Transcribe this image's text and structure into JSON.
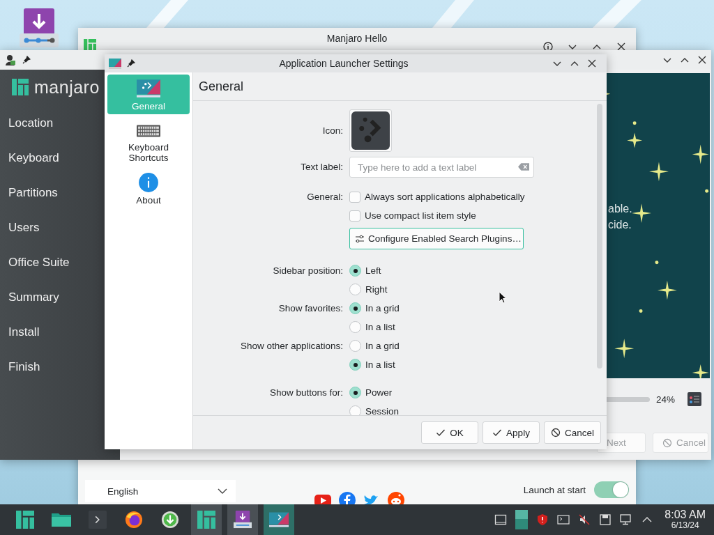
{
  "hello_window": {
    "title": "Manjaro Hello",
    "language": "English",
    "launch_at_start": {
      "label": "Launch at start",
      "on": true
    }
  },
  "installer_window": {
    "brand": "manjaro",
    "steps": [
      {
        "label": "Location",
        "selected": false
      },
      {
        "label": "Keyboard",
        "selected": false
      },
      {
        "label": "Partitions",
        "selected": false
      },
      {
        "label": "Users",
        "selected": false
      },
      {
        "label": "Office Suite",
        "selected": false
      },
      {
        "label": "Summary",
        "selected": false
      },
      {
        "label": "Install",
        "selected": false
      },
      {
        "label": "Finish",
        "selected": false
      }
    ],
    "slide_lines": [
      "able.",
      "cide."
    ],
    "progress": {
      "reading": "24%"
    },
    "buttons": [
      {
        "label": "Next",
        "kind": "next",
        "disabled": true
      },
      {
        "label": "Cancel",
        "kind": "cancel",
        "disabled": true
      }
    ]
  },
  "settings_dialog": {
    "title": "Application Launcher Settings",
    "pages": [
      {
        "label": "General",
        "kind": "general",
        "selected": true
      },
      {
        "label": "Keyboard Shortcuts",
        "kind": "keyboard",
        "selected": false
      },
      {
        "label": "About",
        "kind": "about",
        "selected": false
      }
    ],
    "heading": "General",
    "sections": [
      {
        "rows": [
          {
            "kind": "icon",
            "label": "Icon:"
          },
          {
            "kind": "text",
            "label": "Text label:",
            "placeholder": "Type here to add a text label"
          }
        ]
      },
      {
        "rows": [
          {
            "kind": "checks",
            "label": "General:",
            "options": [
              {
                "label": "Always sort applications alphabetically",
                "checked": false
              },
              {
                "label": "Use compact list item style",
                "checked": false
              }
            ]
          },
          {
            "kind": "button",
            "text": "Configure Enabled Search Plugins…"
          }
        ]
      },
      {
        "rows": [
          {
            "kind": "radios",
            "label": "Sidebar position:",
            "options": [
              {
                "label": "Left",
                "selected": true
              },
              {
                "label": "Right",
                "selected": false
              }
            ]
          },
          {
            "kind": "radios",
            "label": "Show favorites:",
            "options": [
              {
                "label": "In a grid",
                "selected": true
              },
              {
                "label": "In a list",
                "selected": false
              }
            ]
          },
          {
            "kind": "radios",
            "label": "Show other applications:",
            "options": [
              {
                "label": "In a grid",
                "selected": false
              },
              {
                "label": "In a list",
                "selected": true
              }
            ]
          }
        ]
      },
      {
        "rows": [
          {
            "kind": "radios",
            "label": "Show buttons for:",
            "options": [
              {
                "label": "Power",
                "selected": true
              },
              {
                "label": "Session",
                "selected": false
              }
            ]
          }
        ]
      }
    ],
    "buttons": [
      {
        "label": "OK",
        "kind": "ok"
      },
      {
        "label": "Apply",
        "kind": "apply"
      },
      {
        "label": "Cancel",
        "kind": "cancel"
      }
    ]
  },
  "taskbar": {
    "apps": [
      {
        "kind": "launcher",
        "open": false,
        "selected": false
      },
      {
        "kind": "files",
        "open": false,
        "selected": false
      },
      {
        "kind": "terminal",
        "open": false,
        "selected": false
      },
      {
        "kind": "firefox",
        "open": false,
        "selected": false
      },
      {
        "kind": "download",
        "open": false,
        "selected": false
      },
      {
        "kind": "hello",
        "open": true,
        "selected": false
      },
      {
        "kind": "installer",
        "open": true,
        "selected": false
      },
      {
        "kind": "settings",
        "open": true,
        "selected": true
      }
    ],
    "clock": {
      "time": "8:03 AM",
      "date": "6/13/24"
    }
  }
}
